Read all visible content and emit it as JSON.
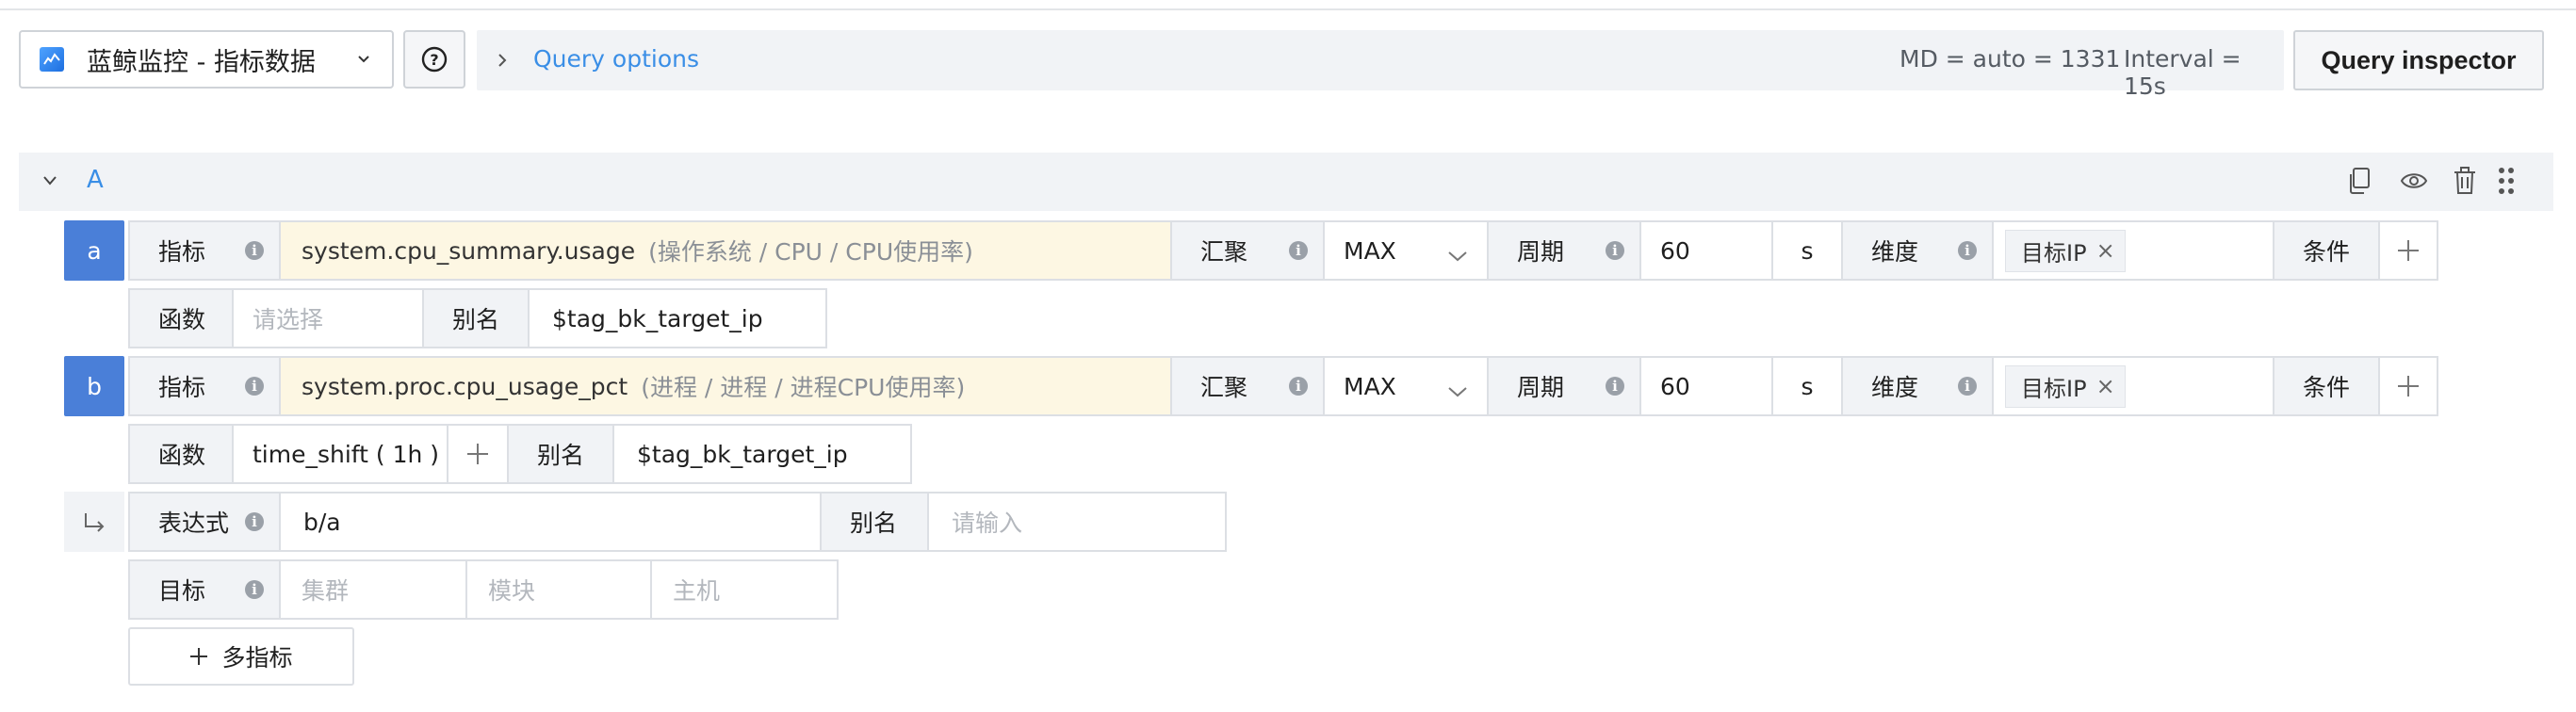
{
  "toolbar": {
    "datasource": "蓝鲸监控 - 指标数据",
    "query_options": "Query options",
    "md_info": "MD = auto = 1331",
    "interval_info": "Interval = 15s",
    "query_inspector": "Query inspector"
  },
  "query": {
    "letter": "A",
    "header_icons": [
      "copy-icon",
      "eye-icon",
      "trash-icon",
      "drag-handle-icon"
    ]
  },
  "metrics": [
    {
      "letter": "a",
      "metric_label": "指标",
      "metric_name": "system.cpu_summary.usage",
      "metric_desc": "(操作系统 / CPU / CPU使用率)",
      "agg_label": "汇聚",
      "agg_value": "MAX",
      "period_label": "周期",
      "period_value": "60",
      "period_unit": "s",
      "dim_label": "维度",
      "dim_tag": "目标IP",
      "cond_label": "条件",
      "func_label": "函数",
      "func_placeholder": "请选择",
      "alias_label": "别名",
      "alias_value": "$tag_bk_target_ip"
    },
    {
      "letter": "b",
      "metric_label": "指标",
      "metric_name": "system.proc.cpu_usage_pct",
      "metric_desc": "(进程 / 进程 / 进程CPU使用率)",
      "agg_label": "汇聚",
      "agg_value": "MAX",
      "period_label": "周期",
      "period_value": "60",
      "period_unit": "s",
      "dim_label": "维度",
      "dim_tag": "目标IP",
      "cond_label": "条件",
      "func_label": "函数",
      "func_value": "time_shift ( 1h )",
      "alias_label": "别名",
      "alias_value": "$tag_bk_target_ip"
    }
  ],
  "expression": {
    "label": "表达式",
    "value": "b/a",
    "alias_label": "别名",
    "alias_placeholder": "请输入"
  },
  "target": {
    "label": "目标",
    "cluster_placeholder": "集群",
    "module_placeholder": "模块",
    "host_placeholder": "主机"
  },
  "add_metric": "多指标",
  "colors": {
    "accent": "#3a8ee6",
    "letter_bg": "#4a7fd8",
    "metric_bg": "#fdf7e3",
    "label_bg": "#f1f3f6"
  }
}
